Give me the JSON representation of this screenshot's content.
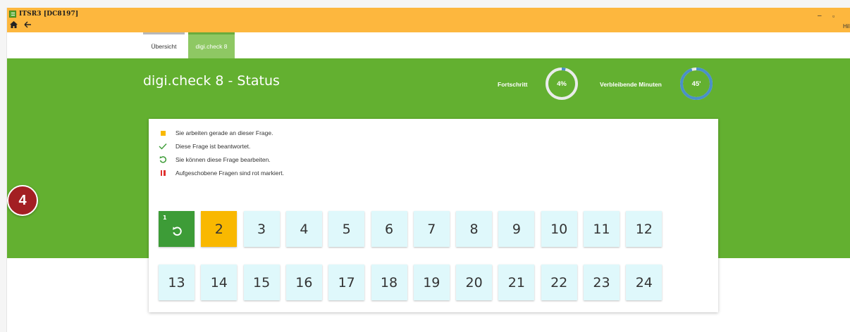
{
  "window": {
    "title": "ITSR3 [DC8197]",
    "home_icon": "home-icon",
    "back_icon": "back-arrow-icon",
    "minimize_symbol": "–",
    "maximize_symbol": "▫",
    "help_label": "Hil"
  },
  "tabs": [
    {
      "label": "Übersicht",
      "active": false
    },
    {
      "label": "digi.check 8",
      "active": true
    }
  ],
  "header": {
    "title": "digi.check 8 - Status",
    "progress_label": "Fortschritt",
    "progress_value": "4%",
    "progress_fraction": 0.04,
    "minutes_label": "Verbleibende Minuten",
    "minutes_value": "45'",
    "minutes_fraction": 0.95
  },
  "legend": [
    {
      "icon": "yellow-square-icon",
      "text": "Sie arbeiten gerade an dieser Frage."
    },
    {
      "icon": "checkmark-icon",
      "text": "Diese Frage ist beantwortet."
    },
    {
      "icon": "edit-refresh-icon",
      "text": "Sie können diese Frage bearbeiten."
    },
    {
      "icon": "pause-icon",
      "text": "Aufgeschobene Fragen sind rot markiert."
    }
  ],
  "questions": [
    {
      "label": "1",
      "state": "answered"
    },
    {
      "label": "2",
      "state": "current"
    },
    {
      "label": "3",
      "state": "open"
    },
    {
      "label": "4",
      "state": "open"
    },
    {
      "label": "5",
      "state": "open"
    },
    {
      "label": "6",
      "state": "open"
    },
    {
      "label": "7",
      "state": "open"
    },
    {
      "label": "8",
      "state": "open"
    },
    {
      "label": "9",
      "state": "open"
    },
    {
      "label": "10",
      "state": "open"
    },
    {
      "label": "11",
      "state": "open"
    },
    {
      "label": "12",
      "state": "open"
    },
    {
      "label": "13",
      "state": "open"
    },
    {
      "label": "14",
      "state": "open"
    },
    {
      "label": "15",
      "state": "open"
    },
    {
      "label": "16",
      "state": "open"
    },
    {
      "label": "17",
      "state": "open"
    },
    {
      "label": "18",
      "state": "open"
    },
    {
      "label": "19",
      "state": "open"
    },
    {
      "label": "20",
      "state": "open"
    },
    {
      "label": "21",
      "state": "open"
    },
    {
      "label": "22",
      "state": "open"
    },
    {
      "label": "23",
      "state": "open"
    },
    {
      "label": "24",
      "state": "open"
    }
  ],
  "annotation": {
    "label": "4"
  },
  "colors": {
    "titlebar": "#fdb73e",
    "band": "#63b030",
    "tab_active": "#8ec863",
    "current": "#f9b800",
    "answered": "#3d9c37",
    "open": "#dff8fb",
    "postponed": "#e0312f",
    "annotation": "#a31f23"
  }
}
